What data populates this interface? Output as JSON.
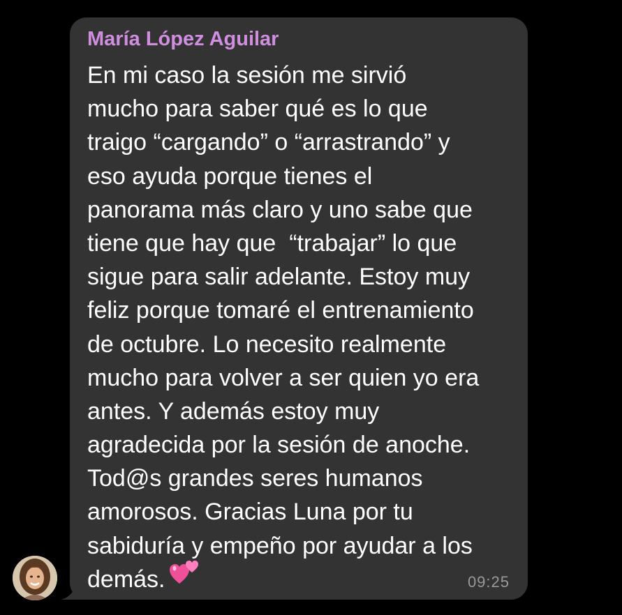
{
  "chat": {
    "message": {
      "sender": "María López Aguilar",
      "lines": [
        "En mi caso la sesión me sirvió",
        "mucho para saber qué es lo que",
        "traigo “cargando” o “arrastrando” y",
        "eso ayuda porque tienes el",
        "panorama más claro y uno sabe que",
        "tiene que hay que  “trabajar” lo que",
        "sigue para salir adelante. Estoy muy",
        "feliz porque tomaré el entrenamiento",
        "de octubre. Lo necesito realmente",
        "mucho para volver a ser quien yo era",
        "antes. Y además estoy muy",
        "agradecida por la sesión de anoche.",
        "Tod@s grandes seres humanos",
        "amorosos. Gracias Luna por tu",
        "sabiduría y empeño por ayudar a los",
        "demás."
      ],
      "emoji": "two-hearts-icon",
      "time": "09:25"
    },
    "colors": {
      "background": "#000000",
      "bubble": "#333333",
      "sender_name": "#cf8ee0",
      "text": "#ffffff",
      "timestamp": "#9a9a9a"
    }
  }
}
